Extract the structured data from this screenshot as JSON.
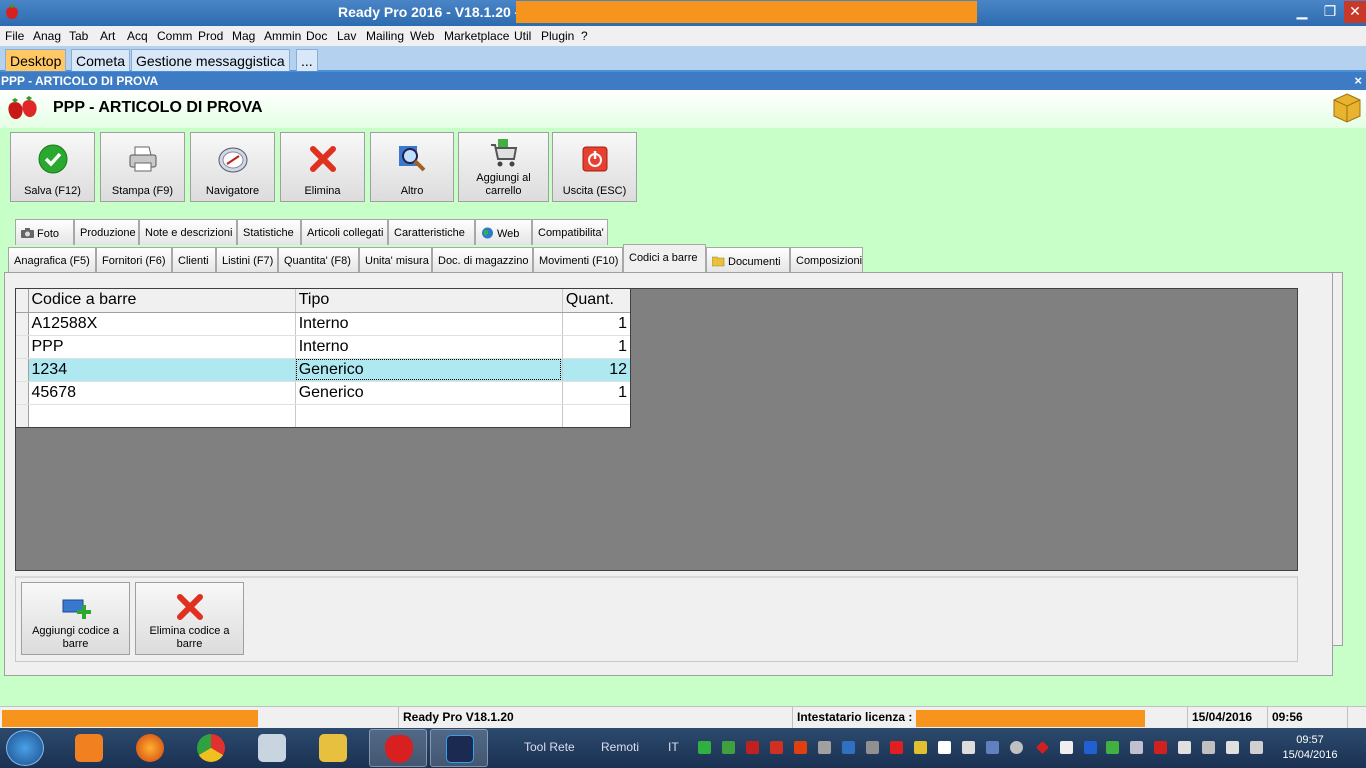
{
  "window": {
    "title": "Ready Pro 2016 - V18.1.20 -",
    "minimize_glyph": "▁",
    "maximize_glyph": "❐",
    "close_glyph": "✕"
  },
  "menu": [
    "File",
    "Anag",
    "Tab",
    "Art",
    "Acq",
    "Comm",
    "Prod",
    "Mag",
    "Ammin",
    "Doc",
    "Lav",
    "Mailing",
    "Web",
    "Marketplace",
    "Util",
    "Plugin",
    "?"
  ],
  "top_tabs": [
    "Desktop",
    "Cometa",
    "Gestione messaggistica",
    "..."
  ],
  "doc_window": {
    "title": "PPP - ARTICOLO DI PROVA",
    "close_glyph": "×"
  },
  "header": {
    "title": "PPP - ARTICOLO DI PROVA"
  },
  "toolbar": [
    {
      "label": "Salva (F12)",
      "icon": "check-icon"
    },
    {
      "label": "Stampa (F9)",
      "icon": "printer-icon"
    },
    {
      "label": "Navigatore",
      "icon": "compass-icon"
    },
    {
      "label": "Elimina",
      "icon": "delete-x-icon"
    },
    {
      "label": "Altro",
      "icon": "magnifier-icon"
    },
    {
      "label": "Aggiungi al carrello",
      "icon": "cart-icon"
    },
    {
      "label": "Uscita (ESC)",
      "icon": "power-icon"
    }
  ],
  "tabs_row1": [
    "Foto",
    "Produzione",
    "Note e descrizioni",
    "Statistiche",
    "Articoli collegati",
    "Caratteristiche",
    "Web",
    "Compatibilita'"
  ],
  "tabs_row2": [
    "Anagrafica (F5)",
    "Fornitori (F6)",
    "Clienti",
    "Listini (F7)",
    "Quantita' (F8)",
    "Unita' misura",
    "Doc. di magazzino",
    "Movimenti (F10)",
    "Codici a barre",
    "Documenti",
    "Composizioni"
  ],
  "active_tab": "Codici a barre",
  "grid": {
    "columns": [
      "Codice a barre",
      "Tipo",
      "Quant."
    ],
    "rows": [
      {
        "code": "A12588X",
        "type": "Interno",
        "qty": "1"
      },
      {
        "code": "PPP",
        "type": "Interno",
        "qty": "1"
      },
      {
        "code": "1234",
        "type": "Generico",
        "qty": "12"
      },
      {
        "code": "45678",
        "type": "Generico",
        "qty": "1"
      }
    ],
    "selected_row": 2
  },
  "actions": [
    {
      "label": "Aggiungi codice a barre",
      "icon": "add-barcode-icon"
    },
    {
      "label": "Elimina codice a barre",
      "icon": "delete-x-icon"
    }
  ],
  "status": {
    "version": "Ready Pro V18.1.20",
    "license_label": "Intestatario licenza :",
    "date": "15/04/2016",
    "time": "09:56"
  },
  "taskbar": {
    "tool_rete": "Tool Rete",
    "remoti": "Remoti",
    "lang": "IT",
    "clock_time": "09:57",
    "clock_date": "15/04/2016"
  },
  "colors": {
    "accent": "#3d7cc4",
    "redaction": "#f7941d",
    "background": "#c8ffc8",
    "selected_row": "#aee8f0"
  }
}
